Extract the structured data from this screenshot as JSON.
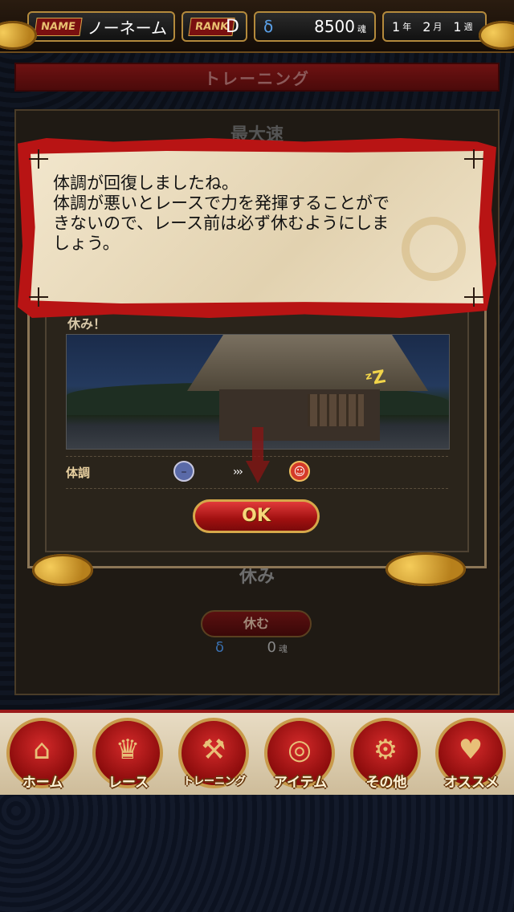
{
  "status": {
    "name_badge": "NAME",
    "name_value": "ノーネーム",
    "rank_badge": "RANK",
    "rank_value": "D",
    "soul_value": "8500",
    "soul_unit": "魂",
    "date": {
      "year": "1",
      "year_unit": "年",
      "month": "2",
      "month_unit": "月",
      "week": "1",
      "week_unit": "週"
    }
  },
  "screen_title": "トレーニング",
  "bg_panel": {
    "title_partial": "最大速",
    "rest_label": "休み",
    "rest_button": "休む",
    "rest_cost": "0",
    "rest_cost_unit": "魂"
  },
  "dialog": {
    "message": "体調が回復しましたね。\n体調が悪いとレースで力を発揮することがで\nきないので、レース前は必ず休むようにしま\nしょう。"
  },
  "result": {
    "partial_heading": "休み！",
    "condition_label": "体調",
    "arrow_text": "›››",
    "ok_label": "OK"
  },
  "nav": [
    {
      "label": "ホーム",
      "icon": "house-icon",
      "glyph": "⌂"
    },
    {
      "label": "レース",
      "icon": "trophy-icon",
      "glyph": "♛"
    },
    {
      "label": "トレーニング",
      "icon": "dumbbell-icon",
      "glyph": "⚒"
    },
    {
      "label": "アイテム",
      "icon": "coins-icon",
      "glyph": "◎"
    },
    {
      "label": "その他",
      "icon": "gear-icon",
      "glyph": "⚙"
    },
    {
      "label": "オススメ",
      "icon": "heart-icon",
      "glyph": "♥"
    }
  ]
}
